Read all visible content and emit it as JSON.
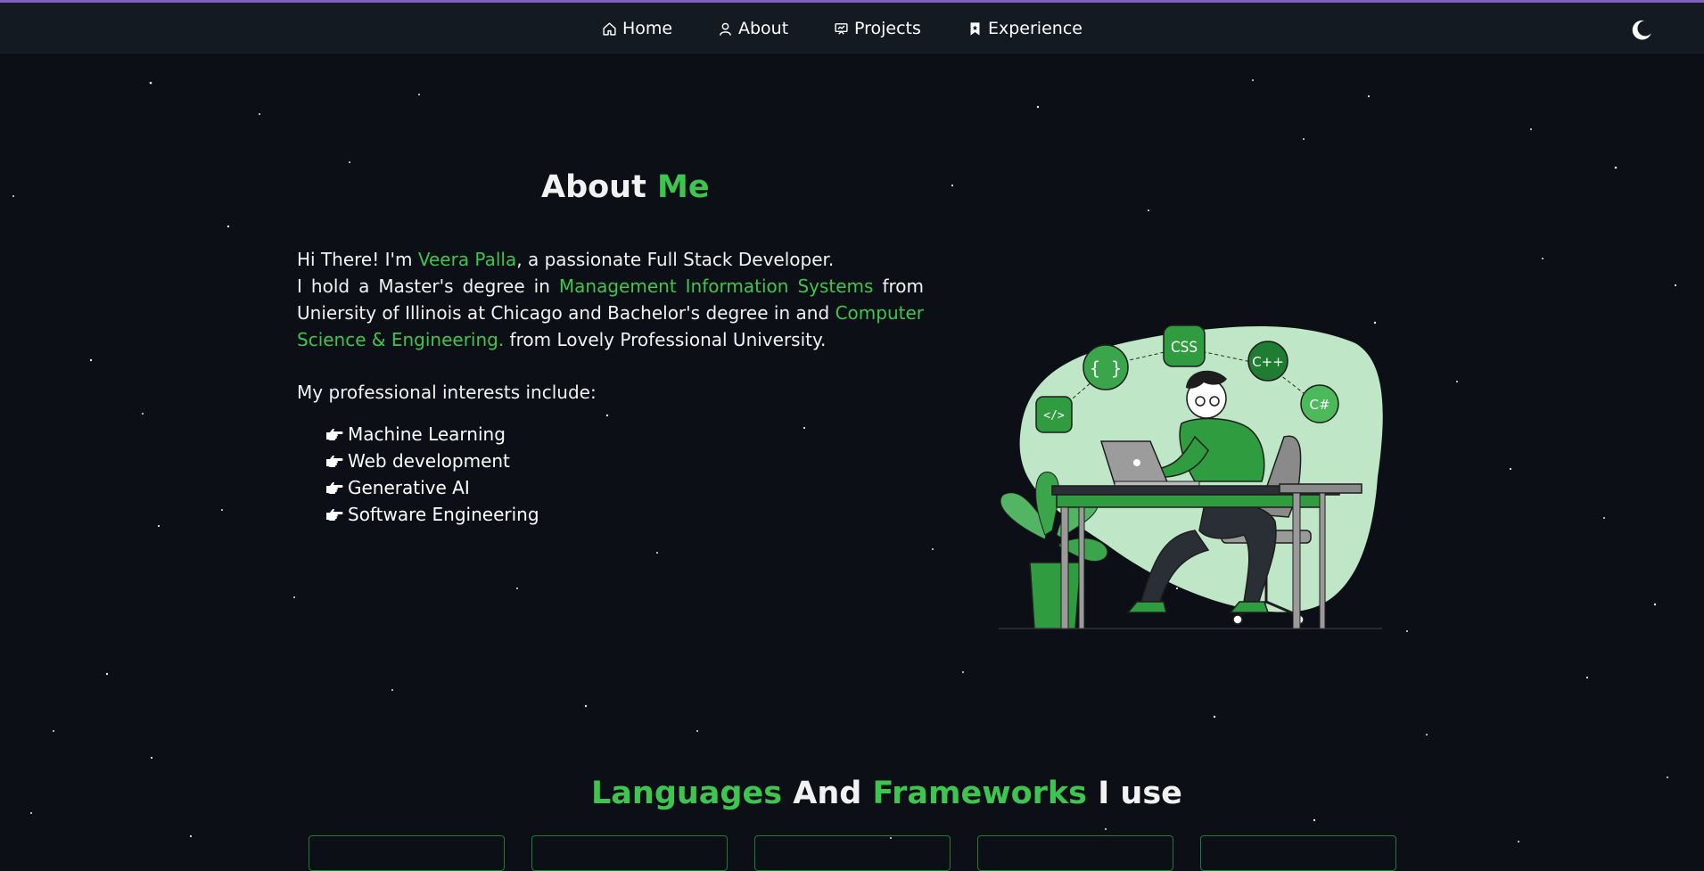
{
  "nav": {
    "items": [
      {
        "label": "Home",
        "icon": "home-icon"
      },
      {
        "label": "About",
        "icon": "user-icon"
      },
      {
        "label": "Projects",
        "icon": "presentation-icon"
      },
      {
        "label": "Experience",
        "icon": "bookmark-icon"
      }
    ],
    "theme_toggle_icon": "moon-icon"
  },
  "about": {
    "title_main": "About",
    "title_accent": "Me",
    "intro_prefix": "Hi There! I'm ",
    "name": "Veera Palla",
    "intro_suffix": ", a passionate Full Stack Developer.",
    "degree_prefix": "I hold a Master's degree in ",
    "masters_field": "Management Information Systems",
    "degree_mid": " from Uniersity of Illinois at Chicago and Bachelor's degree in and ",
    "bachelors_field": "Computer Science & Engineering.",
    "degree_suffix": " from Lovely Professional University.",
    "interests_title": "My professional interests include:",
    "interests": [
      "Machine Learning",
      "Web development",
      "Generative AI",
      "Software Engineering"
    ],
    "illustration_badges": [
      "{ }",
      "CSS",
      "C++",
      "</>",
      "C#"
    ]
  },
  "languages": {
    "title_accent1": "Languages",
    "title_mid": " And ",
    "title_accent2": "Frameworks",
    "title_end": " I use"
  },
  "colors": {
    "accent": "#3ec54f",
    "background": "#0c1016",
    "navbar": "#141a22",
    "top_line": "#7e5fc4"
  }
}
